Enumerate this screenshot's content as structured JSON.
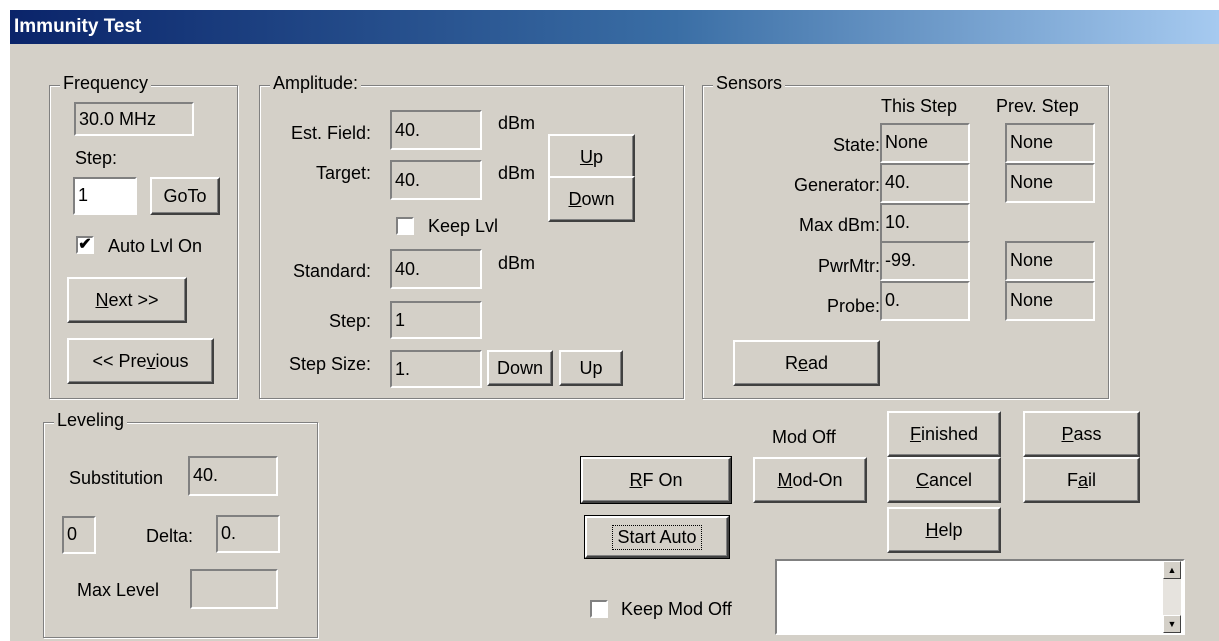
{
  "window": {
    "title": "Immunity Test"
  },
  "frequency": {
    "legend": "Frequency",
    "value": "30.0 MHz",
    "step_label": "Step:",
    "step_value": "1",
    "goto": "GoTo",
    "auto_lvl": {
      "label": "Auto Lvl On",
      "checked": true
    },
    "next": {
      "accel": "N",
      "rest": "ext >>"
    },
    "previous": {
      "pre": "<< Pre",
      "accel": "v",
      "rest": "ious"
    }
  },
  "amplitude": {
    "legend": "Amplitude:",
    "est_field_label": "Est. Field:",
    "est_field_value": "40.",
    "est_field_unit": "dBm",
    "target_label": "Target:",
    "target_value": "40.",
    "target_unit": "dBm",
    "up": {
      "accel": "U",
      "rest": "p"
    },
    "down": {
      "accel": "D",
      "rest": "own"
    },
    "keep_lvl": {
      "label": "Keep Lvl",
      "checked": false
    },
    "standard_label": "Standard:",
    "standard_value": "40.",
    "standard_unit": "dBm",
    "step_label": "Step:",
    "step_value": "1",
    "step_size_label": "Step Size:",
    "step_size_value": "1.",
    "step_down": "Down",
    "step_up": "Up"
  },
  "sensors": {
    "legend": "Sensors",
    "this_step_header": "This Step",
    "prev_step_header": "Prev. Step",
    "rows": [
      {
        "label": "State:",
        "this": "None",
        "prev": "None"
      },
      {
        "label": "Generator:",
        "this": "40.",
        "prev": "None"
      },
      {
        "label": "Max dBm:",
        "this": "10.",
        "prev": ""
      },
      {
        "label": "PwrMtr:",
        "this": "-99.",
        "prev": "None"
      },
      {
        "label": "Probe:",
        "this": "0.",
        "prev": "None"
      }
    ],
    "read": {
      "pre": "R",
      "accel": "e",
      "rest": "ad"
    }
  },
  "leveling": {
    "legend": "Leveling",
    "substitution_label": "Substitution",
    "substitution_value": "40.",
    "index_value": "0",
    "delta_label": "Delta:",
    "delta_value": "0.",
    "max_level_label": "Max Level",
    "max_level_value": ""
  },
  "controls": {
    "mod_status": "Mod Off",
    "rf_on": {
      "accel": "R",
      "rest": "F On"
    },
    "mod_on": {
      "accel": "M",
      "rest": "od-On"
    },
    "finished": {
      "accel": "F",
      "rest": "inished"
    },
    "cancel": {
      "accel": "C",
      "rest": "ancel"
    },
    "help": {
      "accel": "H",
      "rest": "elp"
    },
    "pass": {
      "accel": "P",
      "rest": "ass"
    },
    "fail": {
      "pre": "F",
      "accel": "a",
      "rest": "il"
    },
    "start_auto": "Start Auto",
    "keep_mod_off": {
      "label": "Keep Mod Off",
      "checked": false
    },
    "message_text": ""
  }
}
